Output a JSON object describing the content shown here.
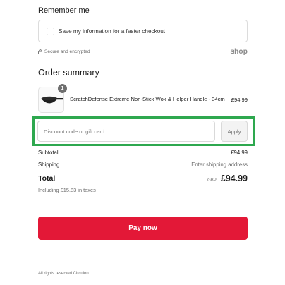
{
  "remember_me": {
    "heading": "Remember me",
    "checkbox_label": "Save my information for a faster checkout",
    "checked": false
  },
  "security": {
    "text": "Secure and encrypted",
    "shop_logo": "shop",
    "icon": "lock-icon"
  },
  "order_summary": {
    "heading": "Order summary",
    "product": {
      "quantity": "1",
      "name": "ScratchDefense Extreme Non-Stick Wok & Helper Handle - 34cm",
      "price": "£94.99"
    },
    "discount": {
      "placeholder": "Discount code or gift card",
      "value": "",
      "apply_label": "Apply",
      "highlight_color": "#2ea84f"
    },
    "subtotal": {
      "label": "Subtotal",
      "value": "£94.99"
    },
    "shipping": {
      "label": "Shipping",
      "value": "Enter shipping address"
    },
    "total": {
      "label": "Total",
      "currency": "GBP",
      "value": "£94.99"
    },
    "tax_note": "Including £15.83 in taxes"
  },
  "pay_button": {
    "label": "Pay now",
    "color": "#e31837"
  },
  "footer": {
    "text": "All rights reserved Circulon"
  }
}
